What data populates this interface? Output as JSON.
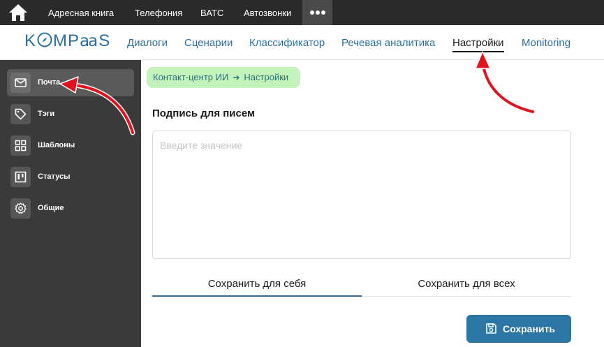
{
  "topbar": {
    "home_icon": "home-icon",
    "links": [
      "Адресная книга",
      "Телефония",
      "ВАТС",
      "Автозвонки"
    ],
    "more_icon": "more-dots-icon"
  },
  "header": {
    "logo": {
      "part1": "K",
      "part2": "MP",
      "part3": "a",
      "part4": "S",
      "brand_color": "#2a6f9b"
    },
    "nav": [
      "Диалоги",
      "Сценарии",
      "Классификатор",
      "Речевая аналитика",
      "Настройки",
      "Monitoring"
    ],
    "active_nav": "Настройки"
  },
  "sidebar": {
    "items": [
      {
        "label": "Почта",
        "icon": "mail-icon",
        "active": true
      },
      {
        "label": "Тэги",
        "icon": "tag-icon",
        "active": false
      },
      {
        "label": "Шаблоны",
        "icon": "grid-icon",
        "active": false
      },
      {
        "label": "Статусы",
        "icon": "board-icon",
        "active": false
      },
      {
        "label": "Общие",
        "icon": "gear-icon",
        "active": false
      }
    ]
  },
  "breadcrumb": {
    "root": "Контакт-центр ИИ",
    "separator_icon": "arrow-right-icon",
    "current": "Настройки",
    "bg_color": "#c3f3ba"
  },
  "signature": {
    "title": "Подпись для писем",
    "value": "",
    "placeholder": "Введите значение"
  },
  "tabs": {
    "items": [
      "Сохранить для себя",
      "Сохранить для всех"
    ],
    "active": "Сохранить для себя"
  },
  "save_button": {
    "label": "Сохранить",
    "icon": "floppy-disk-icon",
    "color": "#2b76a4"
  },
  "annotations": {
    "arrow_color": "#e0141e"
  }
}
